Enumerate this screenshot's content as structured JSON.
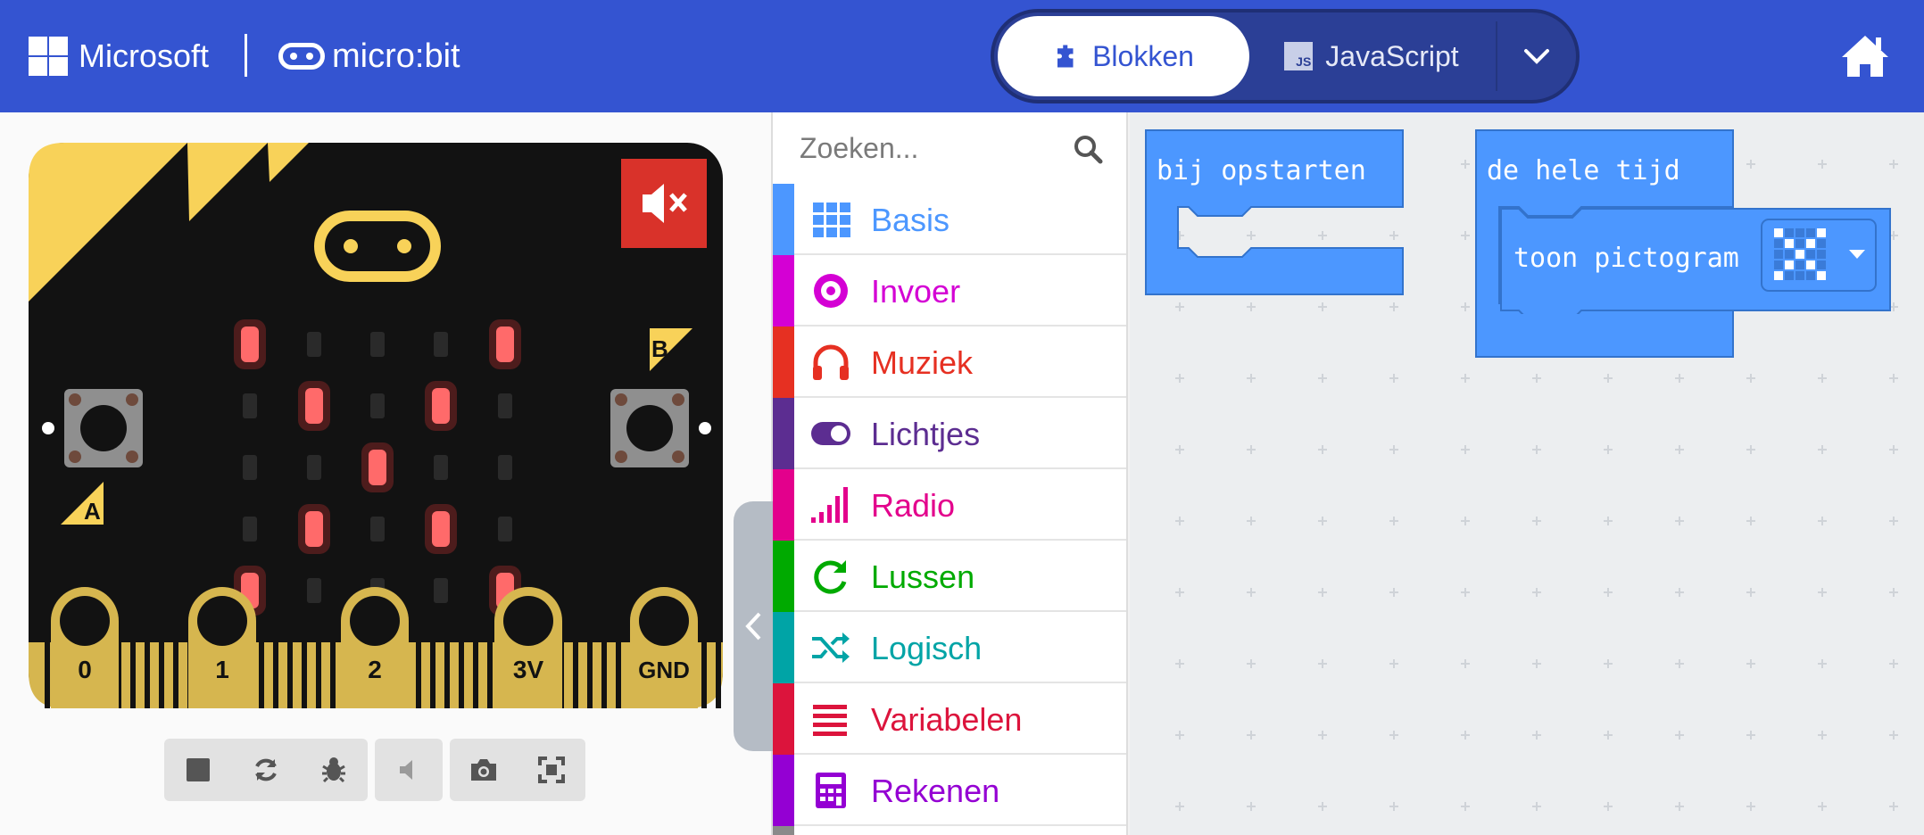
{
  "header": {
    "brand_microsoft": "Microsoft",
    "brand_microbit": "micro:bit",
    "tab_blocks": "Blokken",
    "tab_javascript": "JavaScript",
    "js_badge": "JS",
    "colors": {
      "header": "#3454D1",
      "toggle_bg": "#2b3f96"
    },
    "icons": [
      "microsoft-logo",
      "microbit-logo",
      "puzzle-icon",
      "js-file-icon",
      "chevron-down-icon",
      "home-icon"
    ]
  },
  "simulator": {
    "button_a": "A",
    "button_b": "B",
    "pins": [
      "0",
      "1",
      "2",
      "3V",
      "GND"
    ],
    "led_grid": [
      [
        1,
        0,
        0,
        0,
        1
      ],
      [
        0,
        1,
        0,
        1,
        0
      ],
      [
        0,
        0,
        1,
        0,
        0
      ],
      [
        0,
        1,
        0,
        1,
        0
      ],
      [
        1,
        0,
        0,
        0,
        1
      ]
    ],
    "muted": true,
    "controls": [
      "stop-icon",
      "restart-icon",
      "debug-icon",
      "mute-icon",
      "screenshot-icon",
      "fullscreen-icon"
    ]
  },
  "toolbox": {
    "search_placeholder": "Zoeken...",
    "categories": [
      {
        "label": "Basis",
        "color": "#4C97FF",
        "icon": "grid-icon"
      },
      {
        "label": "Invoer",
        "color": "#D400D4",
        "icon": "target-icon"
      },
      {
        "label": "Muziek",
        "color": "#E63022",
        "icon": "headphones-icon"
      },
      {
        "label": "Lichtjes",
        "color": "#5C2D91",
        "icon": "toggle-icon"
      },
      {
        "label": "Radio",
        "color": "#E3008C",
        "icon": "signal-bars-icon"
      },
      {
        "label": "Lussen",
        "color": "#00AA00",
        "icon": "refresh-icon"
      },
      {
        "label": "Logisch",
        "color": "#00A4A6",
        "icon": "shuffle-icon"
      },
      {
        "label": "Variabelen",
        "color": "#DC143C",
        "icon": "list-lines-icon"
      },
      {
        "label": "Rekenen",
        "color": "#9400D3",
        "icon": "calculator-icon"
      }
    ]
  },
  "workspace": {
    "block_on_start": "bij opstarten",
    "block_forever": "de hele tijd",
    "block_show_icon": "toon pictogram",
    "icon_pattern": [
      [
        1,
        0,
        0,
        0,
        1
      ],
      [
        0,
        1,
        0,
        1,
        0
      ],
      [
        0,
        0,
        1,
        0,
        0
      ],
      [
        0,
        1,
        0,
        1,
        0
      ],
      [
        1,
        0,
        0,
        0,
        1
      ]
    ],
    "block_color": "#4C97FF"
  }
}
